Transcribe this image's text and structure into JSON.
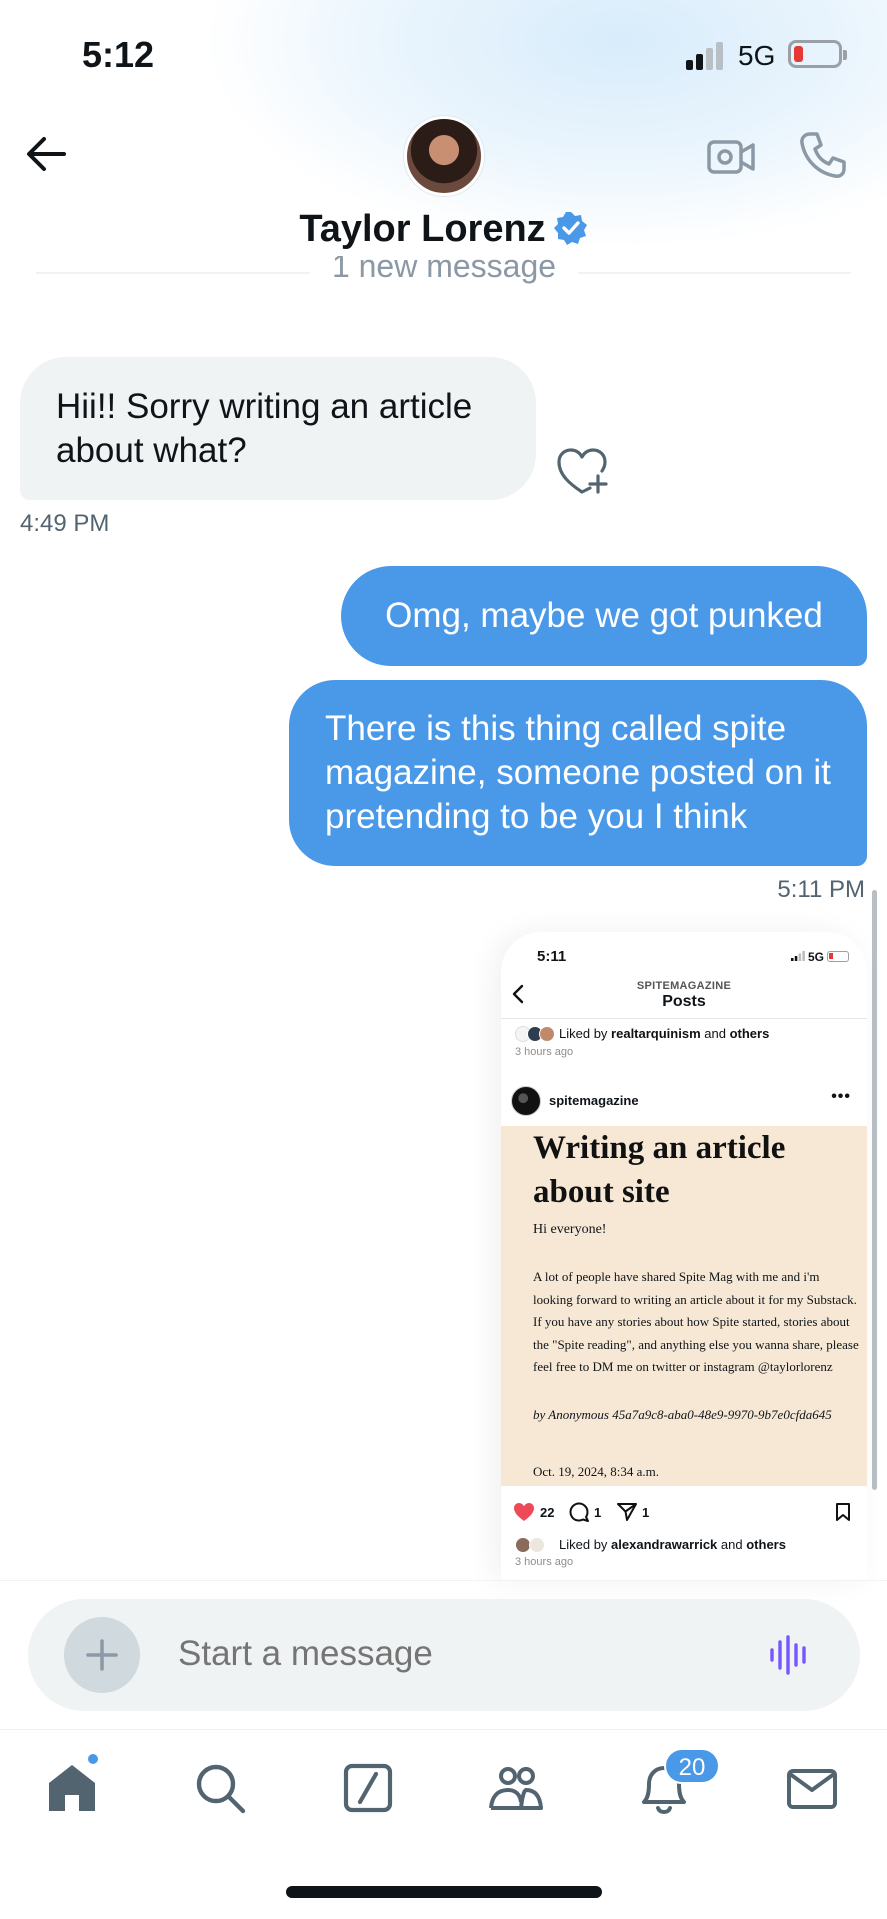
{
  "status_bar": {
    "time": "5:12",
    "network": "5G"
  },
  "header": {
    "contact_name": "Taylor Lorenz",
    "divider_label": "1 new message"
  },
  "messages": {
    "received": {
      "text": "Hii!! Sorry writing an article about what?",
      "time": "4:49 PM"
    },
    "sent_1": {
      "text": "Omg, maybe we got punked"
    },
    "sent_2": {
      "text": "There is this thing called spite magazine, someone posted on it pretending to be you I think",
      "time": "5:11 PM"
    }
  },
  "screenshot": {
    "time": "5:11",
    "network": "5G",
    "account": "SPITEMAGAZINE",
    "page_title": "Posts",
    "liked_prefix": "Liked by",
    "liked_user_top": "realtarquinism",
    "liked_and": "and",
    "liked_others": "others",
    "ago_top": "3 hours ago",
    "post_user": "spitemagazine",
    "post_title": "Writing an article about site",
    "post_greeting": "Hi everyone!",
    "post_paragraph": "A lot of people have shared Spite Mag with me and i'm looking forward to writing an article about it for my Substack. If you have any stories about how Spite started, stories about the \"Spite reading\", and anything else you wanna share, please feel free to DM me on twitter or instagram @taylorlorenz",
    "post_signature": "by Anonymous 45a7a9c8-aba0-48e9-9970-9b7e0cfda645",
    "post_date": "Oct. 19, 2024, 8:34 a.m.",
    "likes_count": "22",
    "comments_count": "1",
    "shares_count": "1",
    "liked_user_bottom": "alexandrawarrick",
    "ago_bottom": "3 hours ago"
  },
  "composer": {
    "placeholder": "Start a message"
  },
  "nav": {
    "notifications_count": "20"
  },
  "colors": {
    "accent": "#4a99e9",
    "bubble_in": "#eff3f4",
    "voice": "#7856ff",
    "like": "#ed4956"
  },
  "icons": [
    "back-arrow-icon",
    "verified-badge-icon",
    "video-call-icon",
    "phone-icon",
    "heart-plus-icon",
    "plus-icon",
    "voice-wave-icon",
    "home-icon",
    "search-icon",
    "grok-icon",
    "communities-icon",
    "bell-icon",
    "mail-icon"
  ]
}
